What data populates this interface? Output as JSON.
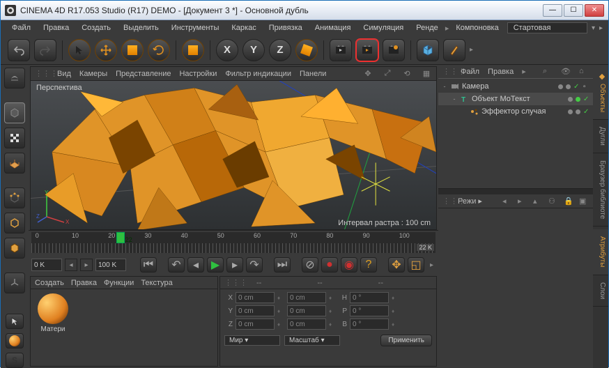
{
  "window": {
    "title": "CINEMA 4D R17.053 Studio (R17) DEMO - [Документ 3 *] - Основной дубль"
  },
  "menu": {
    "items": [
      "Файл",
      "Правка",
      "Создать",
      "Выделить",
      "Инструменты",
      "Каркас",
      "Привязка",
      "Анимация",
      "Симуляция",
      "Ренде",
      "Компоновка"
    ],
    "layout": "Стартовая"
  },
  "viewport": {
    "menu": [
      "Вид",
      "Камеры",
      "Представление",
      "Настройки",
      "Фильтр индикации",
      "Панели"
    ],
    "label": "Перспектива",
    "grid_info": "Интервал растра : 100 cm"
  },
  "timeline": {
    "ticks": [
      "0",
      "10",
      "20",
      "30",
      "40",
      "50",
      "60",
      "70",
      "80",
      "90",
      "100"
    ],
    "current": "22",
    "start": "0 K",
    "end": "100 K",
    "display_end": "22 K"
  },
  "materials": {
    "menu": [
      "Создать",
      "Правка",
      "Функции",
      "Текстура"
    ],
    "items": [
      {
        "label": "Матери"
      }
    ]
  },
  "coords": {
    "head": [
      "--",
      "--",
      "--"
    ],
    "rows": [
      {
        "a": "X",
        "av": "0 cm",
        "bv": "0 cm",
        "c": "H",
        "cv": "0 °"
      },
      {
        "a": "Y",
        "av": "0 cm",
        "bv": "0 cm",
        "c": "P",
        "cv": "0 °"
      },
      {
        "a": "Z",
        "av": "0 cm",
        "bv": "0 cm",
        "c": "B",
        "cv": "0 °"
      }
    ],
    "space": "Мир",
    "mode": "Масштаб",
    "apply": "Применить"
  },
  "objects": {
    "menu": [
      "Файл",
      "Правка"
    ],
    "tree": [
      {
        "indent": 0,
        "toggle": "-",
        "icon": "camera",
        "name": "Камера",
        "sel": false,
        "check": true,
        "box": true
      },
      {
        "indent": 1,
        "toggle": "-",
        "icon": "motext",
        "name": "Объект МоТекст",
        "sel": true,
        "check": true,
        "box": false
      },
      {
        "indent": 2,
        "toggle": "",
        "icon": "random",
        "name": "Эффектор случая",
        "sel": false,
        "check": true,
        "box": false
      }
    ]
  },
  "attributes": {
    "menu_label": "Режи"
  },
  "side_tabs": [
    "Объекты",
    "Дугли",
    "Браузер библиоте",
    "Атрибуты",
    "Слои"
  ]
}
